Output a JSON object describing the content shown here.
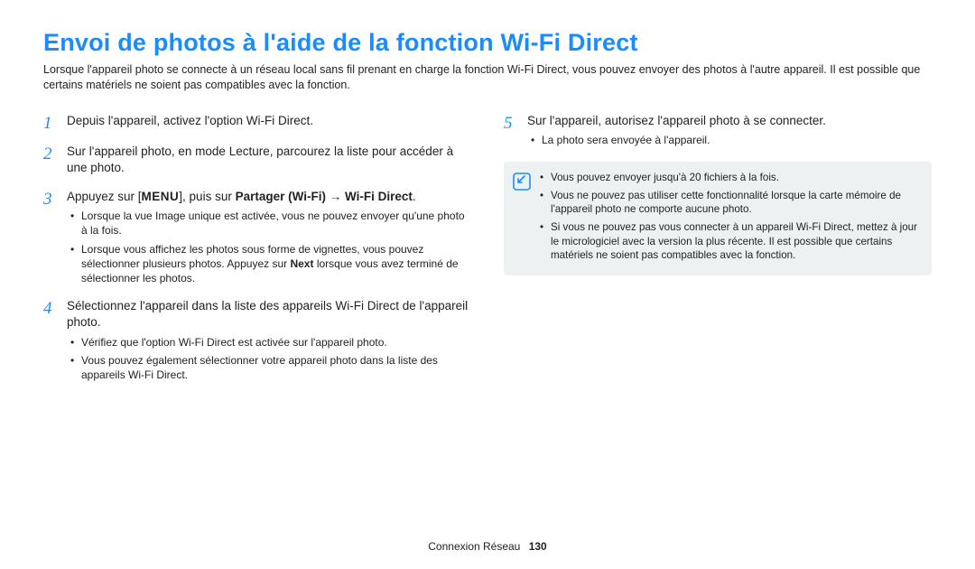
{
  "title": "Envoi de photos à l'aide de la fonction Wi-Fi Direct",
  "intro": "Lorsque l'appareil photo se connecte à un réseau local sans fil prenant en charge la fonction Wi-Fi Direct, vous pouvez envoyer des photos à l'autre appareil. Il est possible que certains matériels ne soient pas compatibles avec la fonction.",
  "left": {
    "s1_num": "1",
    "s1": "Depuis l'appareil, activez l'option Wi-Fi Direct.",
    "s2_num": "2",
    "s2": "Sur l'appareil photo, en mode Lecture, parcourez la liste pour accéder à une photo.",
    "s3_num": "3",
    "s3_pre": "Appuyez sur [",
    "s3_menu": "MENU",
    "s3_mid": "], puis sur ",
    "s3_b1": "Partager (Wi-Fi)",
    "s3_arrow": " → ",
    "s3_b2": "Wi-Fi Direct",
    "s3_end": ".",
    "s3_sub1": "Lorsque la vue Image unique est activée, vous ne pouvez envoyer qu'une photo à la fois.",
    "s3_sub2_a": "Lorsque vous affichez les photos sous forme de vignettes, vous pouvez sélectionner plusieurs photos. Appuyez sur ",
    "s3_sub2_bold": "Next",
    "s3_sub2_b": " lorsque vous avez terminé de sélectionner les photos.",
    "s4_num": "4",
    "s4": "Sélectionnez l'appareil dans la liste des appareils Wi-Fi Direct de l'appareil photo.",
    "s4_sub1": "Vérifiez que l'option Wi-Fi Direct est activée sur l'appareil photo.",
    "s4_sub2": "Vous pouvez également sélectionner votre appareil photo dans la liste des appareils Wi-Fi Direct."
  },
  "right": {
    "s5_num": "5",
    "s5": "Sur l'appareil, autorisez l'appareil photo à se connecter.",
    "s5_sub1": "La photo sera envoyée à l'appareil.",
    "note1": "Vous pouvez envoyer jusqu'à 20 fichiers à la fois.",
    "note2": "Vous ne pouvez pas utiliser cette fonctionnalité lorsque la carte mémoire de l'appareil photo ne comporte aucune photo.",
    "note3": "Si vous ne pouvez pas vous connecter à un appareil Wi-Fi Direct, mettez à jour le micrologiciel avec la version la plus récente. Il est possible que certains matériels ne soient pas compatibles avec la fonction."
  },
  "footer": {
    "section": "Connexion Réseau",
    "page": "130"
  }
}
